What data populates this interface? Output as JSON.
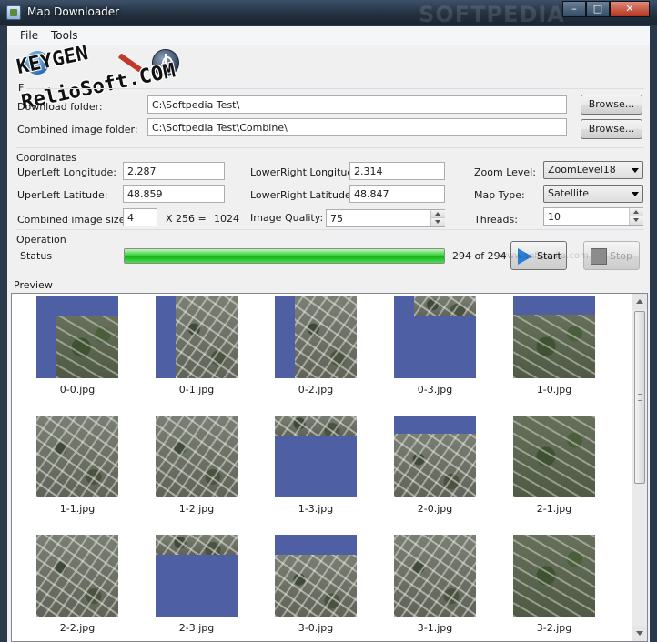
{
  "window": {
    "title": "Map Downloader",
    "controls": {
      "minimize": "–",
      "maximize": "□",
      "close": "✕"
    },
    "background_watermark": "SOFTPEDIA"
  },
  "menu": {
    "file": "File",
    "tools": "Tools"
  },
  "toolbar": {
    "icons": [
      "globe-icon",
      "pencil-icon",
      "power-icon"
    ]
  },
  "watermark": {
    "line1": "KEYGEN",
    "line2": "RelioSoft.COM"
  },
  "folders": {
    "group_title": "F",
    "download_label": "Download folder:",
    "download_value": "C:\\Softpedia Test\\",
    "combined_label": "Combined image folder:",
    "combined_value": "C:\\Softpedia Test\\Combine\\",
    "browse_label": "Browse..."
  },
  "coordinates": {
    "group_title": "Coordinates",
    "ul_lon_label": "UperLeft Longitude:",
    "ul_lon_value": "2.287",
    "ul_lat_label": "UperLeft Latitude:",
    "ul_lat_value": "48.859",
    "lr_lon_label": "LowerRight Longitude:",
    "lr_lon_value": "2.314",
    "lr_lat_label": "LowerRight Latitude:",
    "lr_lat_value": "48.847",
    "combined_size_label": "Combined image size",
    "combined_size_value": "4",
    "combined_size_mult": "X 256 =",
    "combined_size_result": "1024",
    "quality_label": "Image Quality:",
    "quality_value": "75",
    "zoom_label": "Zoom Level:",
    "zoom_value": "ZoomLevel18",
    "maptype_label": "Map Type:",
    "maptype_value": "Satellite",
    "threads_label": "Threads:",
    "threads_value": "10"
  },
  "operation": {
    "group_title": "Operation",
    "status_label": "Status",
    "progress": 1.0,
    "progress_text": "294 of 294",
    "start_label": "Start",
    "stop_label": "Stop"
  },
  "preview": {
    "group_title": "Preview",
    "tiles": [
      {
        "name": "0-0.jpg",
        "cover": "bottom-right",
        "style": "green"
      },
      {
        "name": "0-1.jpg",
        "cover": "right",
        "style": "gray"
      },
      {
        "name": "0-2.jpg",
        "cover": "right-wide",
        "style": "gray"
      },
      {
        "name": "0-3.jpg",
        "cover": "top-strip",
        "style": "gray"
      },
      {
        "name": "1-0.jpg",
        "cover": "bottom-thin",
        "style": "green"
      },
      {
        "name": "1-1.jpg",
        "cover": "full",
        "style": "gray"
      },
      {
        "name": "1-2.jpg",
        "cover": "full",
        "style": "gray"
      },
      {
        "name": "1-3.jpg",
        "cover": "top-thin",
        "style": "gray"
      },
      {
        "name": "2-0.jpg",
        "cover": "bottom-large",
        "style": "gray"
      },
      {
        "name": "2-1.jpg",
        "cover": "full",
        "style": "green"
      },
      {
        "name": "2-2.jpg",
        "cover": "full",
        "style": "gray"
      },
      {
        "name": "2-3.jpg",
        "cover": "top-thin2",
        "style": "gray"
      },
      {
        "name": "3-0.jpg",
        "cover": "bottom-large2",
        "style": "gray"
      },
      {
        "name": "3-1.jpg",
        "cover": "full",
        "style": "gray"
      },
      {
        "name": "3-2.jpg",
        "cover": "full",
        "style": "green"
      }
    ]
  },
  "softpedia_mark": "www.softpedia.com",
  "colors": {
    "progress_green": "#22c22a",
    "ocean_blue": "#4e5fa3",
    "title_bar": "#22303f"
  }
}
